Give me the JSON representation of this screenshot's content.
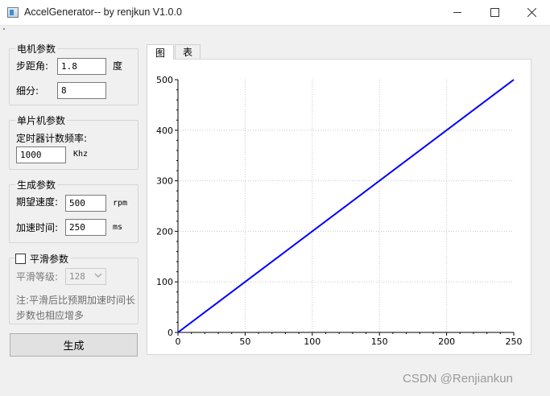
{
  "window": {
    "title": "AccelGenerator-- by renjkun  V1.0.0"
  },
  "motor_params": {
    "group_title": "电机参数",
    "step_angle_label": "步距角:",
    "step_angle_value": "1.8",
    "step_angle_unit": "度",
    "microstep_label": "细分:",
    "microstep_value": "8"
  },
  "mcu_params": {
    "group_title": "单片机参数",
    "timer_freq_label": "定时器计数频率:",
    "timer_freq_value": "1000",
    "timer_freq_unit": "Khz"
  },
  "gen_params": {
    "group_title": "生成参数",
    "speed_label": "期望速度:",
    "speed_value": "500",
    "speed_unit": "rpm",
    "accel_time_label": "加速时间:",
    "accel_time_value": "250",
    "accel_time_unit": "ms"
  },
  "smooth_params": {
    "group_title": "平滑参数",
    "checked": false,
    "level_label": "平滑等级:",
    "level_value": "128",
    "note_line1": "注:平滑后比预期加速时间长",
    "note_line2": "步数也相应增多"
  },
  "generate_button": "生成",
  "tabs": [
    {
      "label": "图",
      "active": true
    },
    {
      "label": "表",
      "active": false
    }
  ],
  "watermark": "CSDN @Renjiankun",
  "chart_data": {
    "type": "line",
    "title": "",
    "xlabel": "",
    "ylabel": "",
    "xlim": [
      0,
      250
    ],
    "ylim": [
      0,
      500
    ],
    "xticks": [
      0,
      50,
      100,
      150,
      200,
      250
    ],
    "yticks": [
      0,
      100,
      200,
      300,
      400,
      500
    ],
    "grid": true,
    "series": [
      {
        "color": "#0000ff",
        "x": [
          0,
          250
        ],
        "y": [
          0,
          500
        ]
      }
    ]
  }
}
